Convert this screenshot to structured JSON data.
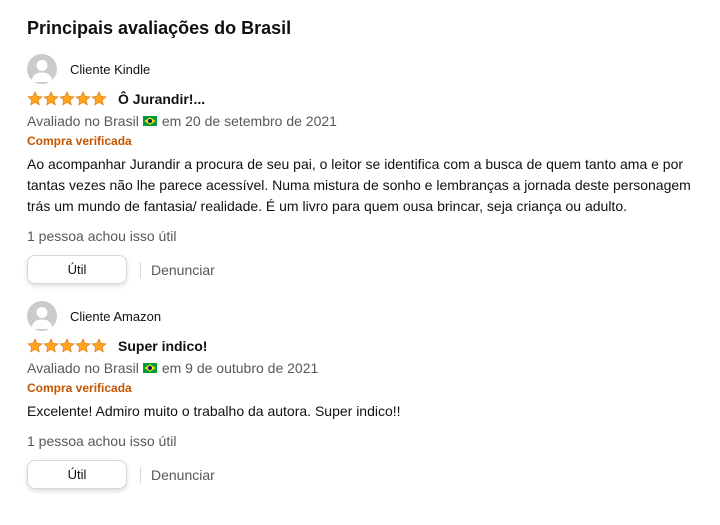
{
  "section": {
    "title": "Principais avaliações do Brasil"
  },
  "colors": {
    "star": "#ffa41c",
    "verified": "#c45500",
    "flag_green": "#009c3b",
    "flag_yellow": "#ffdf00",
    "flag_blue": "#002776"
  },
  "reviews": [
    {
      "author": "Cliente Kindle",
      "rating": 5,
      "title": "Ô Jurandir!...",
      "date_prefix": "Avaliado no Brasil",
      "date_suffix": "em 20 de setembro de 2021",
      "verified": "Compra verificada",
      "body": "Ao acompanhar Jurandir a procura de seu pai, o leitor se identifica com a busca de quem tanto ama e por tantas vezes não lhe parece acessível. Numa mistura de sonho e lembranças a jornada deste personagem trás um mundo de fantasia/ realidade. É um livro para quem ousa brincar, seja criança ou adulto.",
      "helpful": "1 pessoa achou isso útil",
      "helpful_button": "Útil",
      "report": "Denunciar"
    },
    {
      "author": "Cliente Amazon",
      "rating": 5,
      "title": "Super indico!",
      "date_prefix": "Avaliado no Brasil",
      "date_suffix": "em 9 de outubro de 2021",
      "verified": "Compra verificada",
      "body": "Excelente! Admiro muito o trabalho da autora. Super indico!!",
      "helpful": "1 pessoa achou isso útil",
      "helpful_button": "Útil",
      "report": "Denunciar"
    }
  ]
}
